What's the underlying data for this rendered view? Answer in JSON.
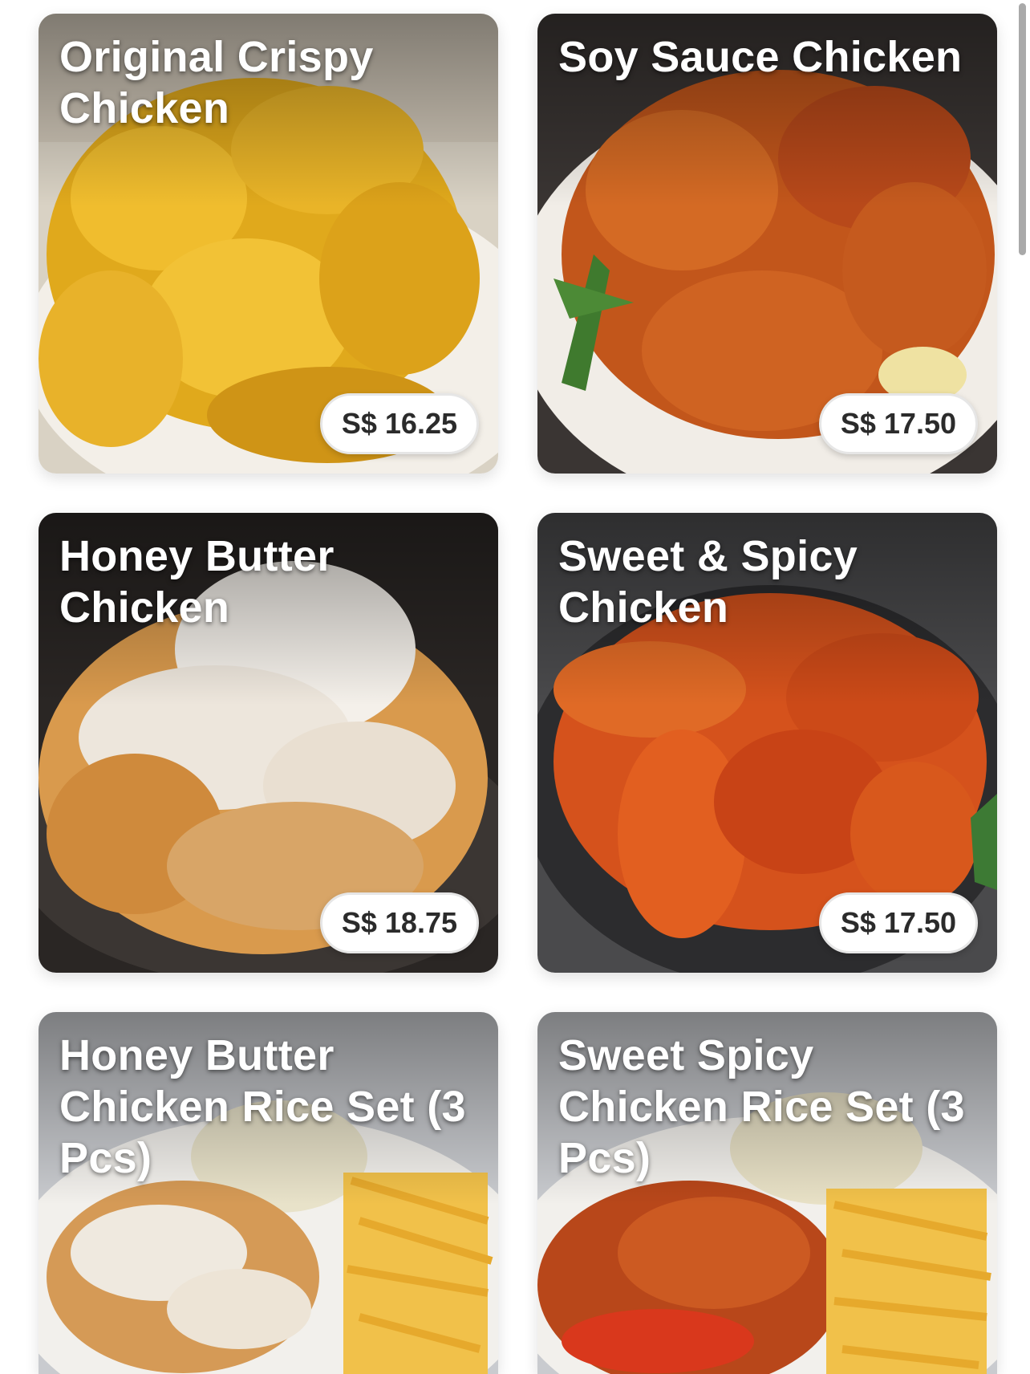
{
  "menu": {
    "items": [
      {
        "name": "Original Crispy Chicken",
        "price": "S$ 16.25",
        "photo": "crispy-chicken-photo"
      },
      {
        "name": "Soy Sauce Chicken",
        "price": "S$ 17.50",
        "photo": "soy-sauce-chicken-photo"
      },
      {
        "name": "Honey Butter Chicken",
        "price": "S$ 18.75",
        "photo": "honey-butter-chicken-photo"
      },
      {
        "name": "Sweet & Spicy Chicken",
        "price": "S$ 17.50",
        "photo": "sweet-spicy-chicken-photo"
      },
      {
        "name": "Honey Butter Chicken Rice Set (3 Pcs)",
        "photo": "honey-butter-rice-set-photo"
      },
      {
        "name": "Sweet Spicy Chicken Rice Set (3 Pcs)",
        "photo": "sweet-spicy-rice-set-photo"
      }
    ]
  },
  "colors": {
    "price_pill_bg": "#ffffff",
    "price_text": "#2b2b2b",
    "title_text": "#ffffff"
  }
}
